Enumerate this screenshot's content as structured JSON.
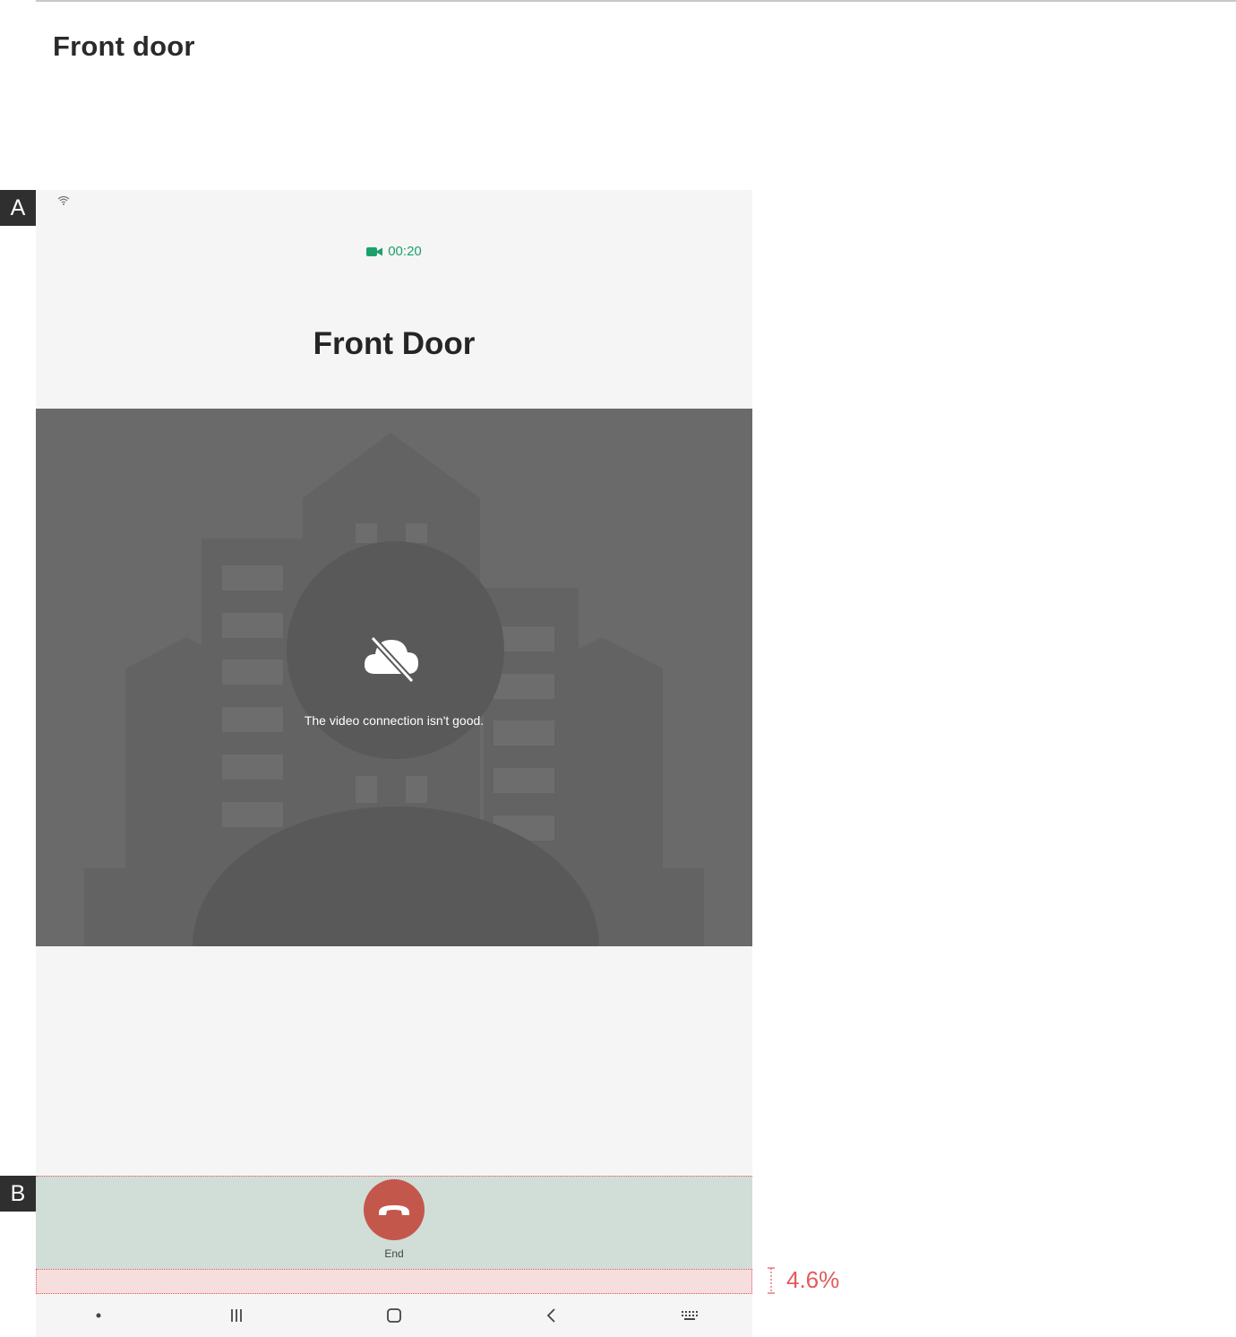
{
  "header": {
    "title": "Front door"
  },
  "markers": {
    "a": "A",
    "b": "B"
  },
  "call": {
    "duration": "00:20",
    "device_name": "Front Door",
    "connection_message": "The video connection isn't good.",
    "end_label": "End"
  },
  "annotation": {
    "safe_area_percent": "4.6%"
  },
  "navbar": {
    "items": [
      "dot-icon",
      "recents-icon",
      "home-icon",
      "back-icon",
      "keyboard-icon"
    ]
  },
  "colors": {
    "accent_green": "#1ba16b",
    "end_red": "#c4574b",
    "annotation_red": "#e35a5a",
    "end_bar_bg": "#d1ddd7"
  }
}
